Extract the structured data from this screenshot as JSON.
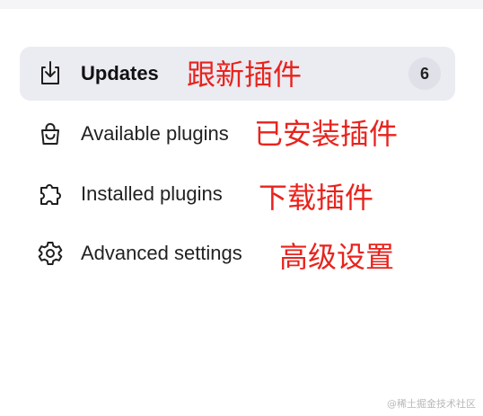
{
  "nav": {
    "items": [
      {
        "label": "Updates",
        "icon": "download-tray-icon",
        "active": true,
        "badge": "6"
      },
      {
        "label": "Available plugins",
        "icon": "shopping-bag-icon",
        "active": false
      },
      {
        "label": "Installed plugins",
        "icon": "puzzle-piece-icon",
        "active": false
      },
      {
        "label": "Advanced settings",
        "icon": "gear-icon",
        "active": false
      }
    ]
  },
  "annotations": [
    "跟新插件",
    "已安装插件",
    "下载插件",
    "高级设置"
  ],
  "watermark": "@稀土掘金技术社区",
  "colors": {
    "active_bg": "#ebebf2",
    "badge_bg": "#e0e0e8",
    "annotation": "#e8231d"
  }
}
